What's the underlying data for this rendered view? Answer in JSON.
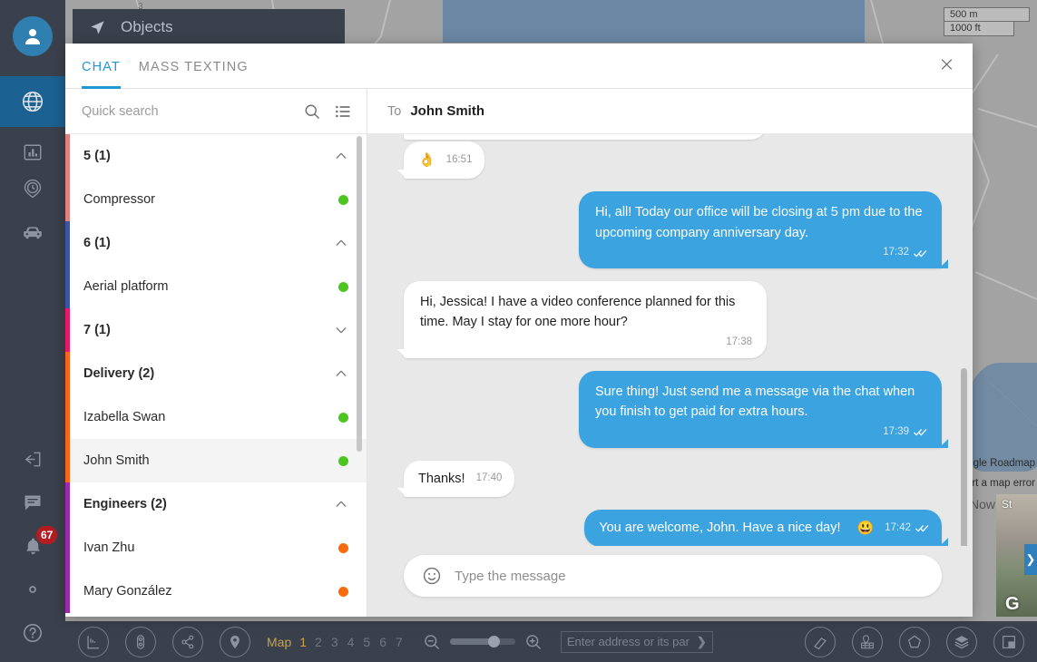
{
  "map": {
    "scale_metric": "500 m",
    "scale_imperial": "1000 ft",
    "attribution": "gle Roadmap",
    "report_error": "ort a map error",
    "now_label": "Now",
    "streetview_label": "St",
    "streetview_logo": "G",
    "streetview_arrow": "❯"
  },
  "rail": {
    "avatar_icon": "user-avatar-icon",
    "items": [
      {
        "icon": "globe-icon",
        "name": "monitoring",
        "active": true
      },
      {
        "icon": "bar-chart-icon",
        "name": "reports",
        "active": false
      },
      {
        "icon": "clock-location-icon",
        "name": "history",
        "active": false
      },
      {
        "icon": "car-icon",
        "name": "vehicles",
        "active": false
      },
      {
        "icon": "login-box-icon",
        "name": "login",
        "active": false
      },
      {
        "icon": "chat-bubble-icon",
        "name": "chat",
        "active": false
      },
      {
        "icon": "bell-icon",
        "name": "notifications",
        "active": false,
        "badge": "67"
      },
      {
        "icon": "gear-icon",
        "name": "settings",
        "active": false
      },
      {
        "icon": "question-mark-icon",
        "name": "help",
        "active": false
      }
    ]
  },
  "objects_tab": {
    "title": "Objects",
    "icon": "navigation-arrow-icon"
  },
  "panel": {
    "tabs": [
      {
        "label": "CHAT",
        "active": true
      },
      {
        "label": "MASS TEXTING",
        "active": false
      }
    ],
    "close_icon": "×"
  },
  "search": {
    "placeholder": "Quick search",
    "value": "",
    "search_icon": "search-icon",
    "list_icon": "list-view-icon"
  },
  "chat_list": [
    {
      "type": "group",
      "label": "5 (1)",
      "expanded": true,
      "color": "#e08080"
    },
    {
      "type": "chat",
      "label": "Compressor",
      "status": "#4dc521",
      "color": "#e08080",
      "selected": false
    },
    {
      "type": "group",
      "label": "6 (1)",
      "expanded": true,
      "color": "#3b55a8"
    },
    {
      "type": "chat",
      "label": "Aerial platform",
      "status": "#4dc521",
      "color": "#3b55a8",
      "selected": false
    },
    {
      "type": "group",
      "label": "7 (1)",
      "expanded": false,
      "color": "#e8176a"
    },
    {
      "type": "group",
      "label": "Delivery (2)",
      "expanded": true,
      "color": "#f9641a"
    },
    {
      "type": "chat",
      "label": "Izabella Swan",
      "status": "#4dc521",
      "color": "#f9641a",
      "selected": false
    },
    {
      "type": "chat",
      "label": "John Smith",
      "status": "#4dc521",
      "color": "#f9641a",
      "selected": true
    },
    {
      "type": "group",
      "label": "Engineers (2)",
      "expanded": true,
      "color": "#9c27b0"
    },
    {
      "type": "chat",
      "label": "Ivan Zhu",
      "status": "#f86a0b",
      "color": "#9c27b0",
      "selected": false
    },
    {
      "type": "chat",
      "label": "Mary González",
      "status": "#f86a0b",
      "color": "#9c27b0",
      "selected": false
    }
  ],
  "conversation": {
    "to_label": "To",
    "recipient": "John Smith",
    "messages": [
      {
        "dir": "in",
        "text": "",
        "emoji": "👌",
        "time": "16:51",
        "compact": true,
        "read": false
      },
      {
        "dir": "out",
        "text": "Hi, all! Today our office will be closing at 5 pm due to the upcoming company anniversary day.",
        "time": "17:32",
        "read": true
      },
      {
        "dir": "in",
        "text": "Hi, Jessica! I have a video conference planned for this time. May I stay for one more hour?",
        "time": "17:38",
        "read": false
      },
      {
        "dir": "out",
        "text": "Sure thing! Just send me a message via the chat when you finish to get paid for extra hours.",
        "time": "17:39",
        "read": true
      },
      {
        "dir": "in",
        "text": "Thanks!",
        "time": "17:40",
        "compact": true,
        "read": false
      },
      {
        "dir": "out",
        "text": "You are welcome, John. Have a nice day!",
        "emoji": "😃",
        "time": "17:42",
        "compact": true,
        "read": true
      }
    ]
  },
  "composer": {
    "placeholder": "Type the message",
    "value": "",
    "emoji_icon": "smiley-face-icon"
  },
  "bottom_toolbar": {
    "tools_left": [
      "ruler-icon",
      "traffic-light-icon",
      "share-icon",
      "map-pin-icon"
    ],
    "maps_label": "Map",
    "map_numbers": [
      "1",
      "2",
      "3",
      "4",
      "5",
      "6",
      "7"
    ],
    "active_map": "1",
    "zoom_out_icon": "zoom-out-icon",
    "zoom_in_icon": "zoom-in-icon",
    "zoom_value": 60,
    "address_placeholder": "Enter address or its par",
    "address_value": "",
    "address_submit_icon": "❯",
    "tools_right": [
      "eraser-icon",
      "geofence-icon",
      "polygon-icon",
      "layers-icon",
      "panel-toggle-icon"
    ]
  },
  "colors": {
    "accent": "#2196d4",
    "bubble_out": "#3ba3e0",
    "rail_bg": "#3b414c",
    "rail_active": "#1b6191",
    "badge": "#b51c21"
  }
}
